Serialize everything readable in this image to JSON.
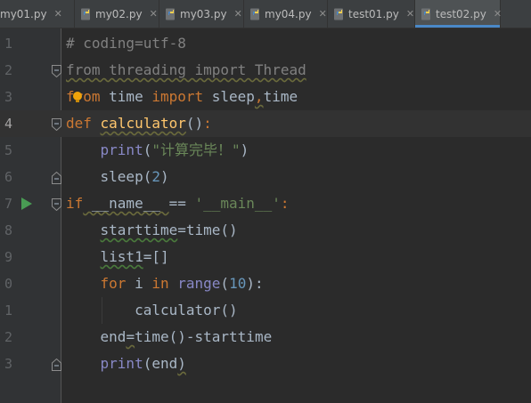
{
  "tabs": [
    {
      "label": "my01.py",
      "active": false
    },
    {
      "label": "my02.py",
      "active": false
    },
    {
      "label": "my03.py",
      "active": false
    },
    {
      "label": "my04.py",
      "active": false
    },
    {
      "label": "test01.py",
      "active": false
    },
    {
      "label": "test02.py",
      "active": true
    }
  ],
  "current_line": 4,
  "lines": [
    {
      "num": "1",
      "tokens": [
        {
          "t": "# coding=utf-8",
          "c": "cm"
        }
      ]
    },
    {
      "num": "2",
      "tokens": [
        {
          "t": "from threading import Thread",
          "c": "un"
        }
      ]
    },
    {
      "num": "3",
      "tokens": [
        {
          "t": "from",
          "c": "kw"
        },
        {
          "t": " time ",
          "c": ""
        },
        {
          "t": "import",
          "c": "kw"
        },
        {
          "t": " sleep",
          "c": ""
        },
        {
          "t": ",",
          "c": "kw wv"
        },
        {
          "t": "time",
          "c": ""
        }
      ]
    },
    {
      "num": "4",
      "tokens": [
        {
          "t": "def",
          "c": "kw"
        },
        {
          "t": " ",
          "c": ""
        },
        {
          "t": "calculator",
          "c": "fn wv"
        },
        {
          "t": "()",
          "c": ""
        },
        {
          "t": ":",
          "c": "kw"
        }
      ]
    },
    {
      "num": "5",
      "tokens": [
        {
          "t": "    print",
          "c": "bi"
        },
        {
          "t": "(",
          "c": ""
        },
        {
          "t": "\"计算完毕！\"",
          "c": "st"
        },
        {
          "t": ")",
          "c": ""
        }
      ]
    },
    {
      "num": "6",
      "tokens": [
        {
          "t": "    sleep(",
          "c": ""
        },
        {
          "t": "2",
          "c": "nu"
        },
        {
          "t": ")",
          "c": ""
        }
      ]
    },
    {
      "num": "7",
      "tokens": [
        {
          "t": "if",
          "c": "kw"
        },
        {
          "t": " __name__ ",
          "c": "wv"
        },
        {
          "t": "== ",
          "c": ""
        },
        {
          "t": "'__main__'",
          "c": "st"
        },
        {
          "t": ":",
          "c": "kw"
        }
      ]
    },
    {
      "num": "8",
      "tokens": [
        {
          "t": "    ",
          "c": ""
        },
        {
          "t": "starttime",
          "c": "wg"
        },
        {
          "t": "=time()",
          "c": ""
        }
      ]
    },
    {
      "num": "9",
      "tokens": [
        {
          "t": "    ",
          "c": ""
        },
        {
          "t": "list1",
          "c": "wg"
        },
        {
          "t": "=[]",
          "c": ""
        }
      ]
    },
    {
      "num": "0",
      "tokens": [
        {
          "t": "    ",
          "c": ""
        },
        {
          "t": "for",
          "c": "kw"
        },
        {
          "t": " i ",
          "c": ""
        },
        {
          "t": "in",
          "c": "kw"
        },
        {
          "t": " ",
          "c": ""
        },
        {
          "t": "range",
          "c": "bi"
        },
        {
          "t": "(",
          "c": ""
        },
        {
          "t": "10",
          "c": "nu"
        },
        {
          "t": "):",
          "c": ""
        }
      ]
    },
    {
      "num": "1",
      "tokens": [
        {
          "t": "        calculator()",
          "c": ""
        }
      ]
    },
    {
      "num": "2",
      "tokens": [
        {
          "t": "    end",
          "c": ""
        },
        {
          "t": "=",
          "c": "wv"
        },
        {
          "t": "time()-starttime",
          "c": ""
        }
      ]
    },
    {
      "num": "3",
      "tokens": [
        {
          "t": "    ",
          "c": ""
        },
        {
          "t": "print",
          "c": "bi"
        },
        {
          "t": "(end",
          "c": ""
        },
        {
          "t": ")",
          "c": "wv"
        }
      ]
    }
  ],
  "colors": {
    "background": "#2b2b2b",
    "gutter": "#313335",
    "keyword": "#cc7832",
    "string": "#6a8759",
    "number": "#6897bb",
    "builtin": "#8888c6",
    "function": "#ffc66d",
    "comment": "#808080",
    "accent": "#4a88c7"
  },
  "icons": {
    "file": "python-file-icon",
    "close": "close-icon",
    "run": "run-icon",
    "intention": "bulb-icon",
    "fold": "fold-marker-icon"
  }
}
